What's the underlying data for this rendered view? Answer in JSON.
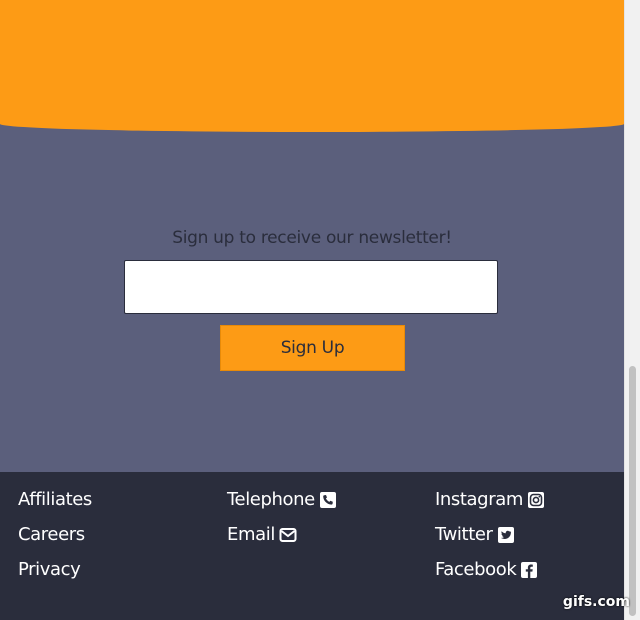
{
  "newsletter": {
    "title": "Sign up to receive our newsletter!",
    "email_value": "",
    "button_label": "Sign Up"
  },
  "footer": {
    "col1": [
      {
        "label": "Affiliates"
      },
      {
        "label": "Careers"
      },
      {
        "label": "Privacy"
      }
    ],
    "col2": [
      {
        "label": "Telephone",
        "icon": "phone-icon"
      },
      {
        "label": "Email",
        "icon": "envelope-icon"
      }
    ],
    "col3": [
      {
        "label": "Instagram",
        "icon": "instagram-icon"
      },
      {
        "label": "Twitter",
        "icon": "twitter-icon"
      },
      {
        "label": "Facebook",
        "icon": "facebook-icon"
      }
    ]
  },
  "watermark": "gifs.com",
  "colors": {
    "accent_orange": "#fd9b15",
    "newsletter_bg": "#5b5f7c",
    "footer_bg": "#2a2d3c",
    "text_dark": "#2a2d3c",
    "text_light": "#ffffff"
  }
}
